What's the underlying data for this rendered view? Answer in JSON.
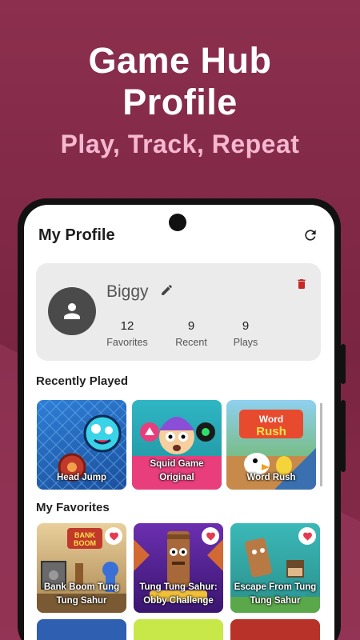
{
  "promo": {
    "headline_line1": "Game Hub",
    "headline_line2": "Profile",
    "tagline": "Play, Track, Repeat"
  },
  "header": {
    "title": "My Profile",
    "refresh_icon": "refresh-icon"
  },
  "profile": {
    "username": "Biggy",
    "avatar_icon": "person-icon",
    "edit_icon": "pencil-icon",
    "delete_icon": "trash-icon",
    "stats": [
      {
        "value": "12",
        "label": "Favorites"
      },
      {
        "value": "9",
        "label": "Recent"
      },
      {
        "value": "9",
        "label": "Plays"
      }
    ]
  },
  "recently_played": {
    "title": "Recently Played",
    "games": [
      {
        "name": "Head Jump"
      },
      {
        "name": "Squid Game Original"
      },
      {
        "name": "Word Rush"
      }
    ]
  },
  "favorites": {
    "title": "My Favorites",
    "games": [
      {
        "name": "Bank Boom Tung Tung Sahur",
        "favorited": true
      },
      {
        "name": "Tung Tung Sahur: Obby Challenge",
        "favorited": true
      },
      {
        "name": "Escape From Tung Tung Sahur",
        "favorited": true
      }
    ]
  },
  "colors": {
    "background": "#8c2f4e",
    "tagline": "#f6b8cf",
    "delete": "#c62828",
    "heart": "#e53950",
    "card_bg": "#ebebeb"
  }
}
